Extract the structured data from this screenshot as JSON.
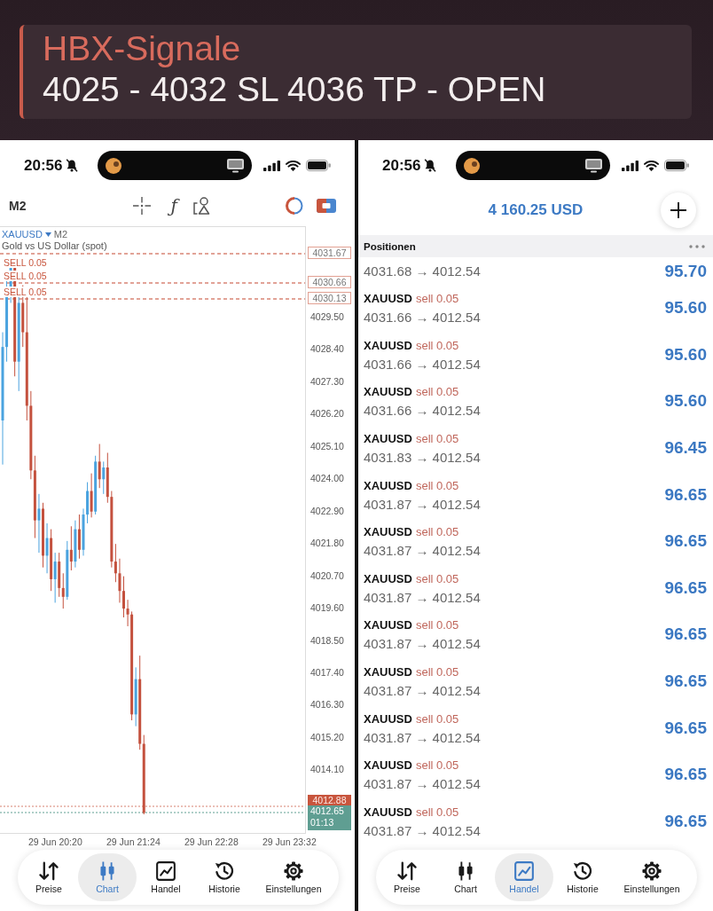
{
  "message": {
    "sender": "HBX-Signale",
    "text": "4025 - 4032 SL 4036 TP - OPEN"
  },
  "screens": [
    {
      "kind": "chart",
      "status_bar": {
        "time": "20:56",
        "silent": true
      },
      "toolbar": {
        "timeframe": "M2",
        "indicator_glyph": "ƒ"
      },
      "chart": {
        "symbol": "XAUUSD",
        "timeframe": "M2",
        "description": "Gold vs US Dollar (spot)",
        "order_lines": [
          {
            "label": "SELL 0.05",
            "price": "4031.67"
          },
          {
            "label": "SELL 0.05",
            "price": "4030.66"
          },
          {
            "label": "SELL 0.05",
            "price": "4030.13"
          }
        ],
        "price_ticks": [
          "4029.50",
          "4028.40",
          "4027.30",
          "4026.20",
          "4025.10",
          "4024.00",
          "4022.90",
          "4021.80",
          "4020.70",
          "4019.60",
          "4018.50",
          "4017.40",
          "4016.30",
          "4015.20",
          "4014.10"
        ],
        "ask_price": "4012.88",
        "bid_price": "4012.65",
        "bar_countdown": "01:13",
        "time_ticks": [
          "29 Jun 20:20",
          "29 Jun 21:24",
          "29 Jun 22:28",
          "29 Jun 23:32"
        ]
      },
      "nav": [
        {
          "label": "Preise",
          "kind": "prices",
          "selected": false
        },
        {
          "label": "Chart",
          "kind": "chart",
          "selected": true
        },
        {
          "label": "Handel",
          "kind": "trade",
          "selected": false
        },
        {
          "label": "Historie",
          "kind": "history",
          "selected": false
        },
        {
          "label": "Einstellungen",
          "kind": "settings",
          "selected": false
        }
      ]
    },
    {
      "kind": "trade",
      "status_bar": {
        "time": "20:56",
        "silent": true
      },
      "balance": "4 160.25 USD",
      "section": "Positionen",
      "positions": [
        {
          "prices": "4031.68 → 4012.54",
          "profit": "95.70"
        },
        {
          "symbol": "XAUUSD",
          "order": "sell 0.05",
          "prices": "4031.66 → 4012.54",
          "profit": "95.60"
        },
        {
          "symbol": "XAUUSD",
          "order": "sell 0.05",
          "prices": "4031.66 → 4012.54",
          "profit": "95.60"
        },
        {
          "symbol": "XAUUSD",
          "order": "sell 0.05",
          "prices": "4031.66 → 4012.54",
          "profit": "95.60"
        },
        {
          "symbol": "XAUUSD",
          "order": "sell 0.05",
          "prices": "4031.83 → 4012.54",
          "profit": "96.45"
        },
        {
          "symbol": "XAUUSD",
          "order": "sell 0.05",
          "prices": "4031.87 → 4012.54",
          "profit": "96.65"
        },
        {
          "symbol": "XAUUSD",
          "order": "sell 0.05",
          "prices": "4031.87 → 4012.54",
          "profit": "96.65"
        },
        {
          "symbol": "XAUUSD",
          "order": "sell 0.05",
          "prices": "4031.87 → 4012.54",
          "profit": "96.65"
        },
        {
          "symbol": "XAUUSD",
          "order": "sell 0.05",
          "prices": "4031.87 → 4012.54",
          "profit": "96.65"
        },
        {
          "symbol": "XAUUSD",
          "order": "sell 0.05",
          "prices": "4031.87 → 4012.54",
          "profit": "96.65"
        },
        {
          "symbol": "XAUUSD",
          "order": "sell 0.05",
          "prices": "4031.87 → 4012.54",
          "profit": "96.65"
        },
        {
          "symbol": "XAUUSD",
          "order": "sell 0.05",
          "prices": "4031.87 → 4012.54",
          "profit": "96.65"
        },
        {
          "symbol": "XAUUSD",
          "order": "sell 0.05",
          "prices": "4031.87 → 4012.54",
          "profit": "96.65"
        }
      ],
      "nav": [
        {
          "label": "Preise",
          "kind": "prices",
          "selected": false
        },
        {
          "label": "Chart",
          "kind": "chart",
          "selected": false
        },
        {
          "label": "Handel",
          "kind": "trade",
          "selected": true
        },
        {
          "label": "Historie",
          "kind": "history",
          "selected": false
        },
        {
          "label": "Einstellungen",
          "kind": "settings",
          "selected": false
        }
      ]
    }
  ]
}
